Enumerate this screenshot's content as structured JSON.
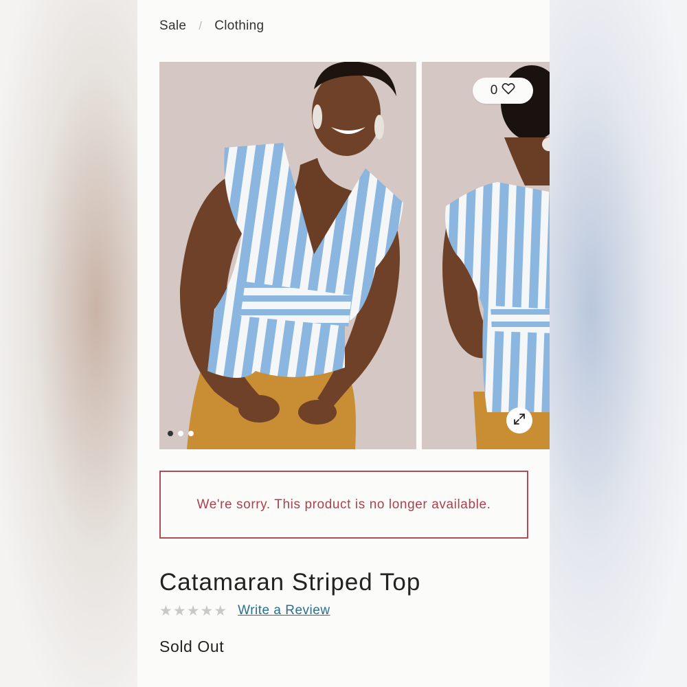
{
  "breadcrumb": {
    "items": [
      "Sale",
      "Clothing"
    ],
    "separator": "/"
  },
  "gallery": {
    "images": [
      "model-front-photo",
      "model-back-photo"
    ],
    "slide_count": 3,
    "active_slide": 1
  },
  "wishlist": {
    "count": "0",
    "icon": "heart-icon"
  },
  "notice": {
    "message": "We're sorry. This product is no longer available."
  },
  "product": {
    "title": "Catamaran Striped Top",
    "rating_stars": 0,
    "review_link": "Write a Review",
    "status": "Sold Out"
  },
  "colors": {
    "accent_link": "#2b6f8e",
    "notice_border": "#b04a55",
    "notice_text": "#a8424e"
  }
}
